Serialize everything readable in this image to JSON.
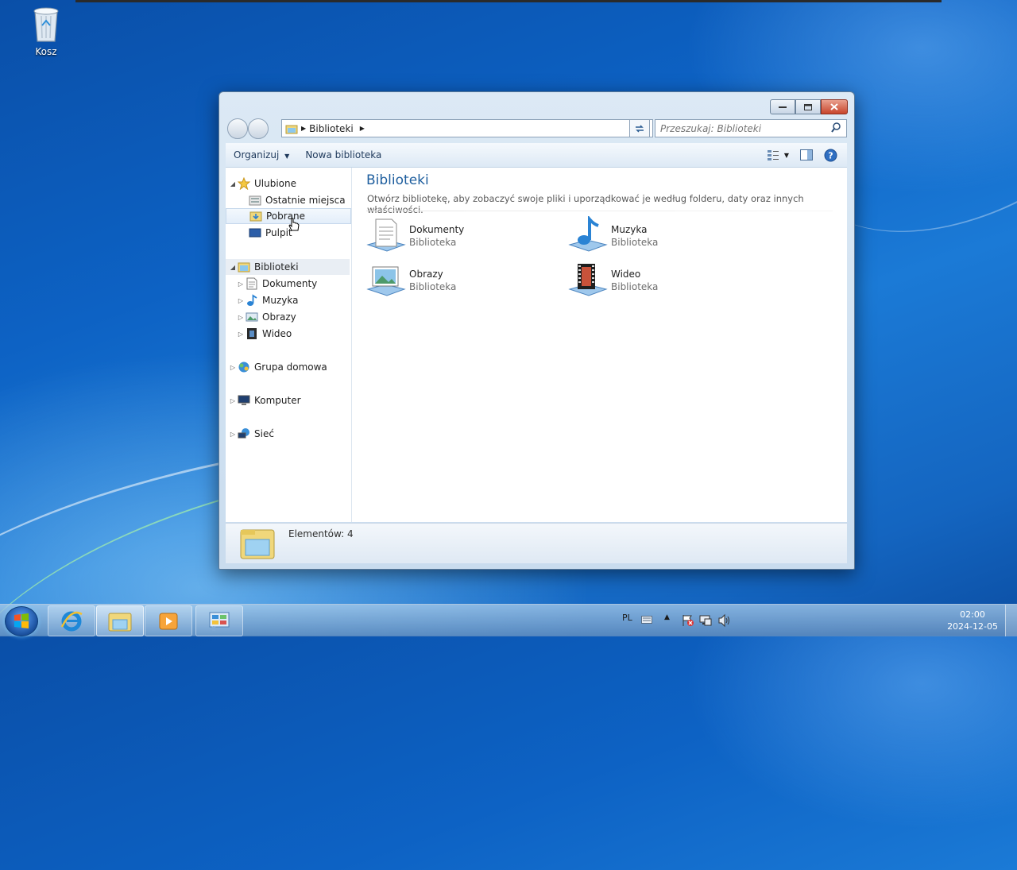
{
  "desktop": {
    "recycle_bin_label": "Kosz"
  },
  "explorer": {
    "address": {
      "crumb": "Biblioteki"
    },
    "search_placeholder": "Przeszukaj: Biblioteki",
    "command_bar": {
      "organize": "Organizuj",
      "new_library": "Nowa biblioteka"
    },
    "nav_pane": {
      "favorites": "Ulubione",
      "favorites_items": [
        "Ostatnie miejsca",
        "Pobrane",
        "Pulpit"
      ],
      "libraries": "Biblioteki",
      "library_items": [
        "Dokumenty",
        "Muzyka",
        "Obrazy",
        "Wideo"
      ],
      "homegroup": "Grupa domowa",
      "computer": "Komputer",
      "network": "Sieć"
    },
    "main": {
      "title": "Biblioteki",
      "description": "Otwórz bibliotekę, aby zobaczyć swoje pliki i uporządkować je według folderu, daty oraz innych właściwości.",
      "libraries": [
        {
          "name": "Dokumenty",
          "type": "Biblioteka",
          "icon": "documents-library-icon"
        },
        {
          "name": "Muzyka",
          "type": "Biblioteka",
          "icon": "music-library-icon"
        },
        {
          "name": "Obrazy",
          "type": "Biblioteka",
          "icon": "pictures-library-icon"
        },
        {
          "name": "Wideo",
          "type": "Biblioteka",
          "icon": "videos-library-icon"
        }
      ]
    },
    "details": {
      "count": "Elementów: 4"
    }
  },
  "taskbar": {
    "pinned": [
      "internet-explorer-icon",
      "windows-explorer-icon",
      "media-player-icon",
      "control-panel-icon"
    ],
    "language": "PL",
    "time": "02:00",
    "date": "2024-12-05"
  },
  "colors": {
    "accent_title": "#1e5e9e",
    "close_button": "#c8452c"
  }
}
